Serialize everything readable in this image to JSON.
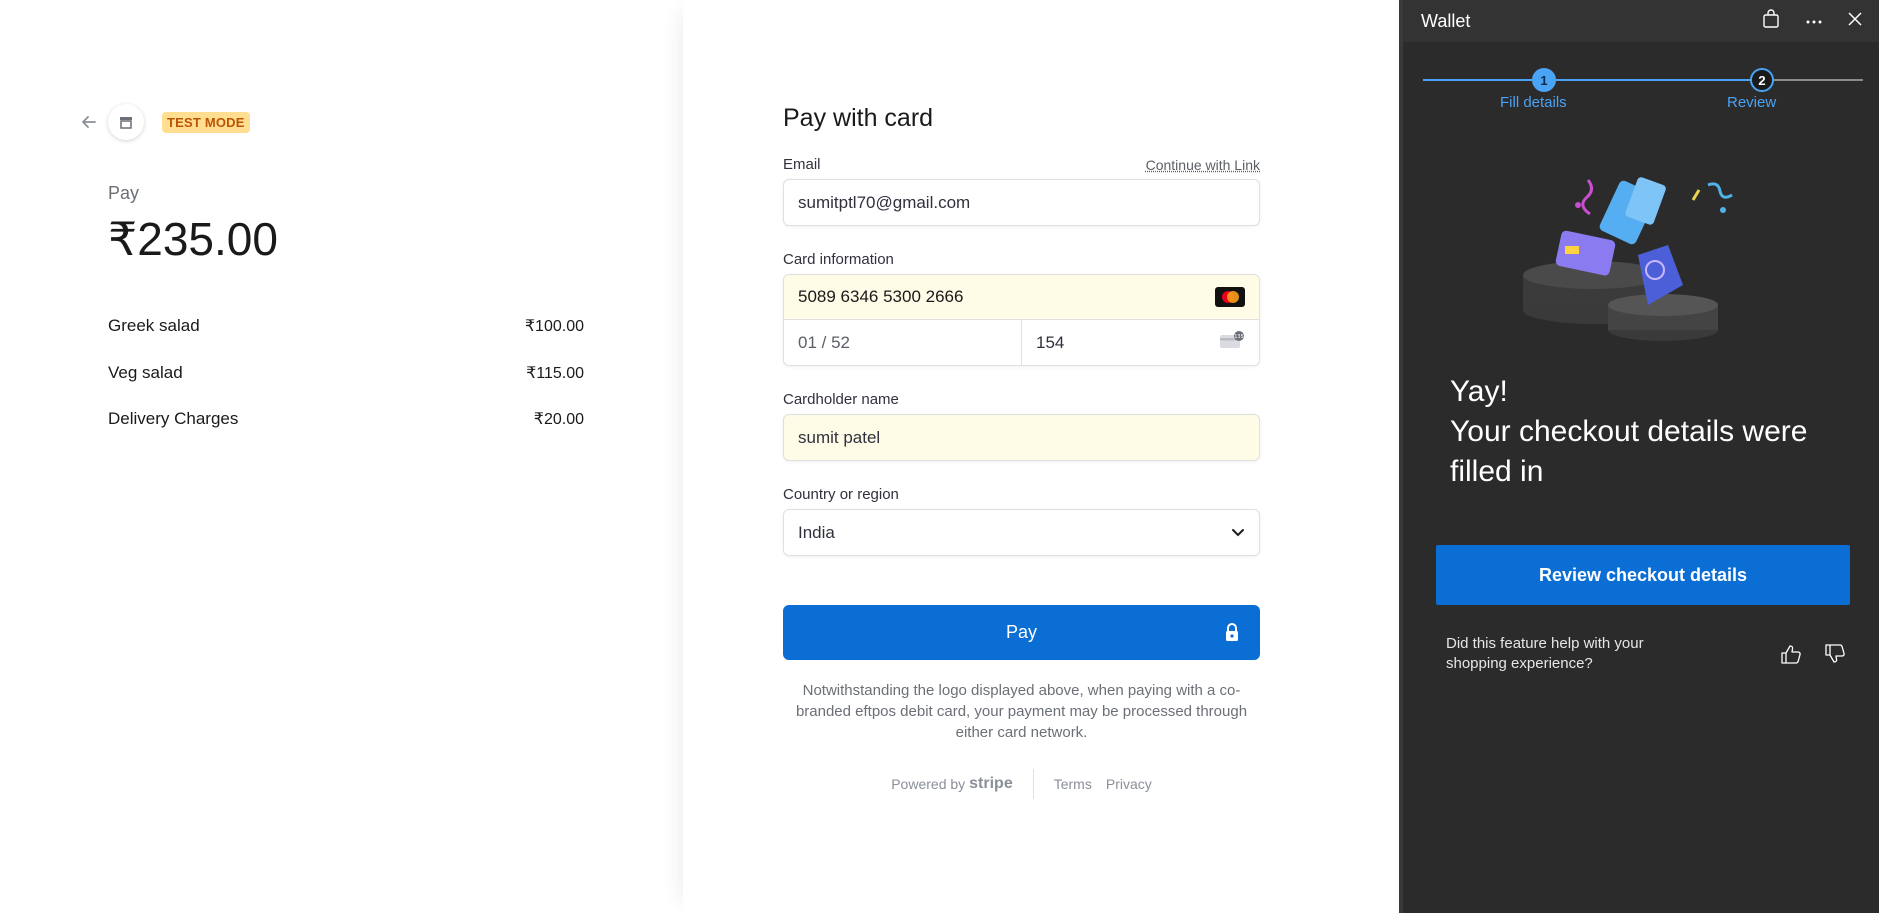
{
  "summary": {
    "badge": "TEST MODE",
    "pay_label": "Pay",
    "total": "₹235.00",
    "items": [
      {
        "name": "Greek salad",
        "price": "₹100.00"
      },
      {
        "name": "Veg salad",
        "price": "₹115.00"
      },
      {
        "name": "Delivery Charges",
        "price": "₹20.00"
      }
    ]
  },
  "form": {
    "title": "Pay with card",
    "email_label": "Email",
    "continue_link": "Continue with Link",
    "email_value": "sumitptl70@gmail.com",
    "card_label": "Card information",
    "card_number": "5089 6346 5300 2666",
    "expiry": "01 / 52",
    "cvc": "154",
    "name_label": "Cardholder name",
    "name_value": "sumit patel",
    "country_label": "Country or region",
    "country_value": "India",
    "pay_button": "Pay",
    "note": "Notwithstanding the logo displayed above, when paying with a co-branded eftpos debit card, your payment may be processed through either card network.",
    "powered_by": "Powered by",
    "stripe": "stripe",
    "terms": "Terms",
    "privacy": "Privacy"
  },
  "wallet": {
    "title": "Wallet",
    "steps": [
      {
        "num": "1",
        "label": "Fill details"
      },
      {
        "num": "2",
        "label": "Review"
      }
    ],
    "headline_line1": "Yay!",
    "headline_line2": "Your checkout details were filled in",
    "review_button": "Review checkout details",
    "feedback_text": "Did this feature help with your shopping experience?"
  },
  "colors": {
    "accent": "#0b6ed4",
    "wallet_bg": "#2b2b2b",
    "step_blue": "#4aa3f5",
    "autofill_bg": "#fefbe7",
    "badge_bg": "#ffde92"
  }
}
